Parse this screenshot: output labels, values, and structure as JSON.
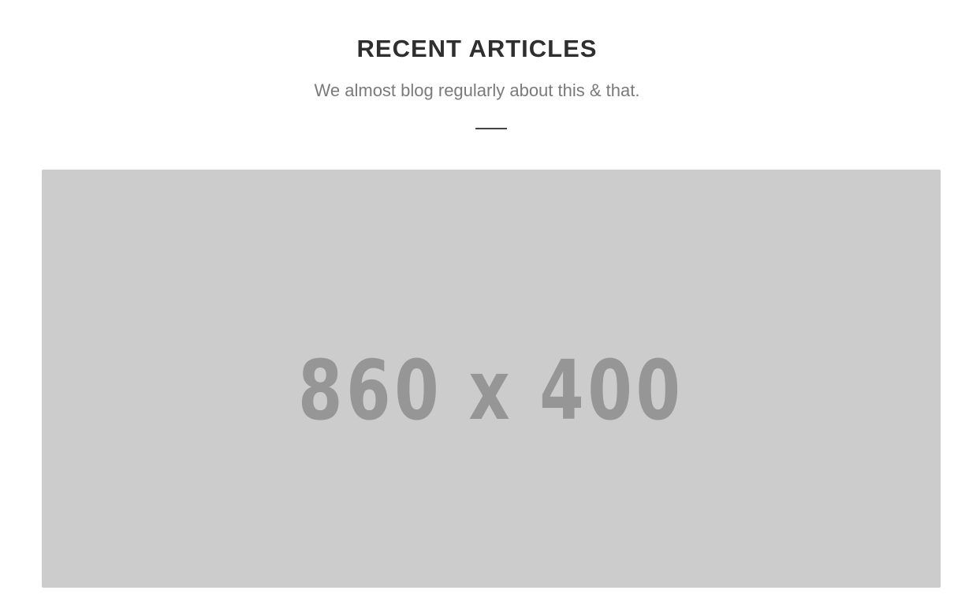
{
  "section": {
    "title": "RECENT ARTICLES",
    "subtitle": "We almost blog regularly about this & that."
  },
  "featured_image": {
    "placeholder_text": "860 x 400"
  },
  "colors": {
    "background": "#ffffff",
    "title": "#2f2f2f",
    "subtitle": "#7a7a7a",
    "divider": "#444444",
    "placeholder_bg": "#cccccc",
    "placeholder_text": "#969696"
  }
}
